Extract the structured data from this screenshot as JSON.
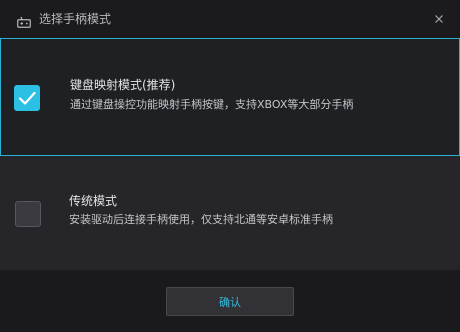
{
  "dialog": {
    "title": "选择手柄模式",
    "icons": {
      "title": "gamepad-icon",
      "close": "close-icon",
      "check": "checkmark-icon"
    }
  },
  "options": [
    {
      "title": "键盘映射模式(推荐)",
      "description": "通过键盘操控功能映射手柄按键，支持XBOX等大部分手柄",
      "checked": true
    },
    {
      "title": "传统模式",
      "description": "安装驱动后连接手柄使用，仅支持北通等安卓标准手柄",
      "checked": false
    }
  ],
  "footer": {
    "confirm_label": "确认"
  },
  "colors": {
    "accent": "#2cc0e4",
    "selected_border": "#2ab0d0",
    "background": "#1a1a1c",
    "panel": "#26262a"
  }
}
